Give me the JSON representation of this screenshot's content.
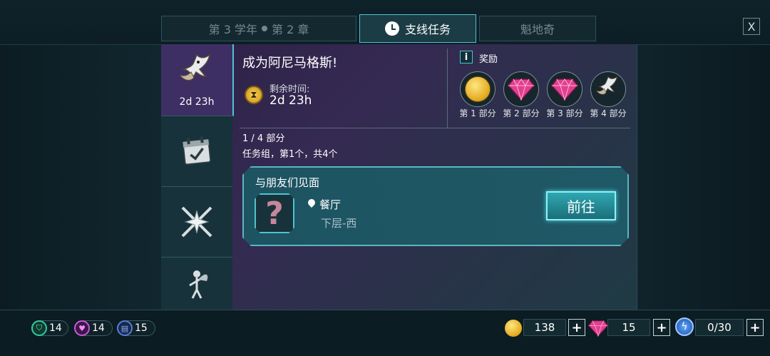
{
  "tabs": {
    "year_label": "第 3 学年",
    "chapter_label": "第 2 章",
    "side_quests": "支线任务",
    "quidditch": "魁地奇"
  },
  "close_label": "X",
  "sidebar": {
    "active_time": "2d 23h"
  },
  "quest": {
    "title": "成为阿尼马格斯!",
    "time_label": "剩余时间:",
    "time_value": "2d 23h"
  },
  "rewards": {
    "info_label": "i",
    "label": "奖励",
    "items": [
      {
        "label": "第 1 部分",
        "icon": "coin-icon"
      },
      {
        "label": "第 2 部分",
        "icon": "gem-icon"
      },
      {
        "label": "第 3 部分",
        "icon": "gem-icon"
      },
      {
        "label": "第 4 部分",
        "icon": "owl-icon"
      }
    ]
  },
  "progress": {
    "parts": "1 / 4 部分",
    "group": "任务组，第1个，共4个"
  },
  "task": {
    "title": "与朋友们见面",
    "mystery": "?",
    "location": "餐厅",
    "sublocation": "下层-西",
    "go_label": "前往"
  },
  "stats": {
    "courage": "14",
    "empathy": "14",
    "knowledge": "15"
  },
  "resources": {
    "coins": "138",
    "gems": "15",
    "energy": "0/30",
    "plus": "+"
  },
  "colors": {
    "accent": "#4ec3cf",
    "panel_purple": "#352a52",
    "gem": "#e0408f",
    "coin": "#e2a81b"
  }
}
